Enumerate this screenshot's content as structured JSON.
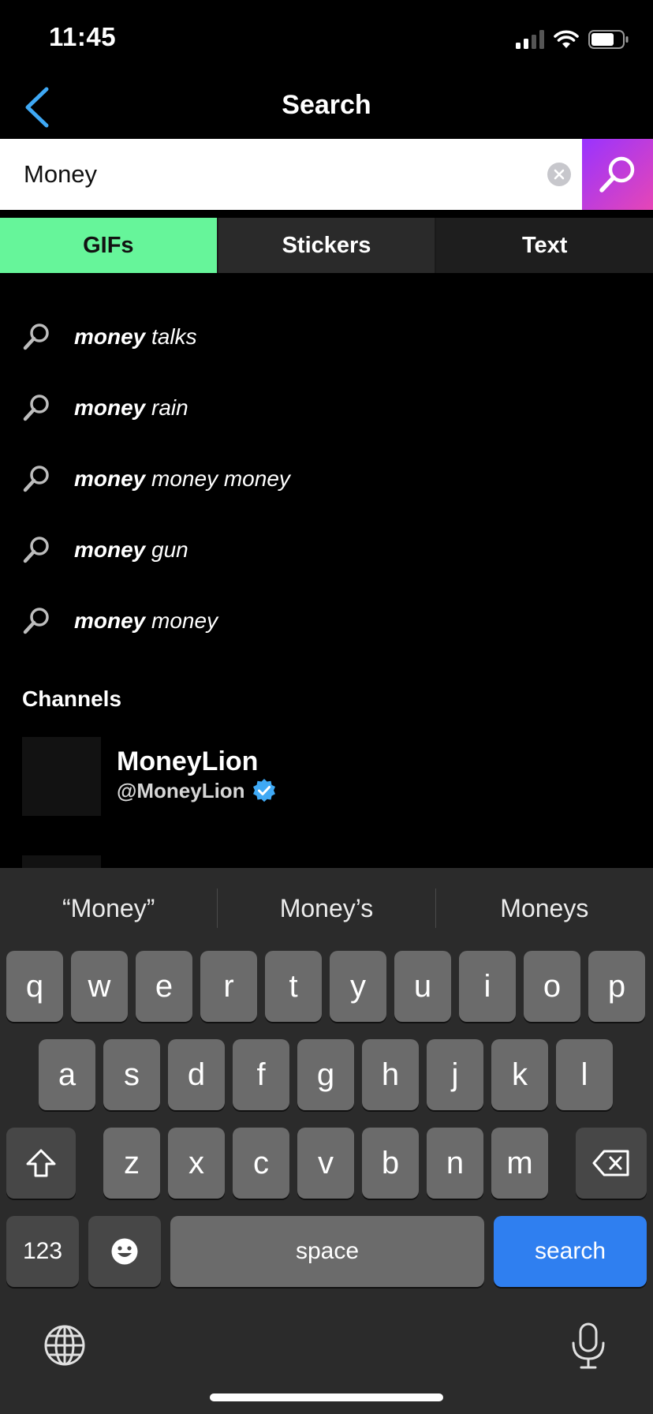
{
  "status_bar": {
    "time": "11:45"
  },
  "nav": {
    "title": "Search"
  },
  "search": {
    "value": "Money"
  },
  "tabs": [
    {
      "label": "GIFs",
      "active": true
    },
    {
      "label": "Stickers",
      "active": false
    },
    {
      "label": "Text",
      "active": false
    }
  ],
  "suggestions": [
    {
      "bold": "money",
      "rest": " talks"
    },
    {
      "bold": "money",
      "rest": " rain"
    },
    {
      "bold": "money",
      "rest": " money money"
    },
    {
      "bold": "money",
      "rest": " gun"
    },
    {
      "bold": "money",
      "rest": " money"
    }
  ],
  "channels": {
    "header": "Channels",
    "items": [
      {
        "name": "MoneyLion",
        "handle": "@MoneyLion",
        "verified": true
      }
    ]
  },
  "keyboard": {
    "predictions": [
      "“Money”",
      "Money’s",
      "Moneys"
    ],
    "row1": [
      "q",
      "w",
      "e",
      "r",
      "t",
      "y",
      "u",
      "i",
      "o",
      "p"
    ],
    "row2": [
      "a",
      "s",
      "d",
      "f",
      "g",
      "h",
      "j",
      "k",
      "l"
    ],
    "row3": [
      "z",
      "x",
      "c",
      "v",
      "b",
      "n",
      "m"
    ],
    "numbers_label": "123",
    "space_label": "space",
    "return_label": "search"
  },
  "colors": {
    "tab_active": "#66f59a",
    "search_gradient_start": "#9933ff",
    "search_gradient_end": "#e646b6",
    "back_accent": "#3fa9f5",
    "verified": "#3fa9f5",
    "key_search": "#2f7ff0"
  }
}
